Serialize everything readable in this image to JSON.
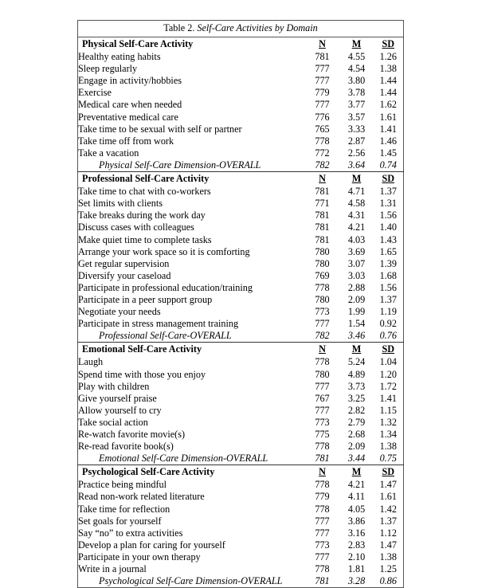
{
  "table": {
    "caption_label": "Table 2.",
    "caption_title": "Self-Care Activities by Domain",
    "columns": {
      "label": "",
      "n": "N",
      "m": "M",
      "sd": "SD"
    },
    "sections": [
      {
        "header": "Physical Self-Care Activity",
        "rows": [
          {
            "label": "Healthy eating habits",
            "n": "781",
            "m": "4.55",
            "sd": "1.26"
          },
          {
            "label": "Sleep regularly",
            "n": "777",
            "m": "4.54",
            "sd": "1.38"
          },
          {
            "label": "Engage in activity/hobbies",
            "n": "777",
            "m": "3.80",
            "sd": "1.44"
          },
          {
            "label": "Exercise",
            "n": "779",
            "m": "3.78",
            "sd": "1.44"
          },
          {
            "label": "Medical care when needed",
            "n": "777",
            "m": "3.77",
            "sd": "1.62"
          },
          {
            "label": "Preventative medical care",
            "n": "776",
            "m": "3.57",
            "sd": "1.61"
          },
          {
            "label": "Take time to be sexual with self or partner",
            "n": "765",
            "m": "3.33",
            "sd": "1.41"
          },
          {
            "label": "Take time off from work",
            "n": "778",
            "m": "2.87",
            "sd": "1.46"
          },
          {
            "label": "Take a vacation",
            "n": "772",
            "m": "2.56",
            "sd": "1.45"
          }
        ],
        "overall": {
          "label": "Physical Self-Care Dimension-OVERALL",
          "n": "782",
          "m": "3.64",
          "sd": "0.74"
        }
      },
      {
        "header": "Professional Self-Care Activity",
        "rows": [
          {
            "label": "Take time to chat with co-workers",
            "n": "781",
            "m": "4.71",
            "sd": "1.37"
          },
          {
            "label": "Set limits with clients",
            "n": "771",
            "m": "4.58",
            "sd": "1.31"
          },
          {
            "label": "Take breaks during the work day",
            "n": "781",
            "m": "4.31",
            "sd": "1.56"
          },
          {
            "label": "Discuss cases with colleagues",
            "n": "781",
            "m": "4.21",
            "sd": "1.40"
          },
          {
            "label": "Make quiet time to complete tasks",
            "n": "781",
            "m": "4.03",
            "sd": "1.43"
          },
          {
            "label": "Arrange your work space so it is comforting",
            "n": "780",
            "m": "3.69",
            "sd": "1.65"
          },
          {
            "label": "Get regular supervision",
            "n": "780",
            "m": "3.07",
            "sd": "1.39"
          },
          {
            "label": "Diversify your caseload",
            "n": "769",
            "m": "3.03",
            "sd": "1.68"
          },
          {
            "label": "Participate in professional education/training",
            "n": "778",
            "m": "2.88",
            "sd": "1.56"
          },
          {
            "label": "Participate in a peer support group",
            "n": "780",
            "m": "2.09",
            "sd": "1.37"
          },
          {
            "label": "Negotiate your needs",
            "n": "773",
            "m": "1.99",
            "sd": "1.19"
          },
          {
            "label": "Participate in stress management training",
            "n": "777",
            "m": "1.54",
            "sd": "0.92"
          }
        ],
        "overall": {
          "label": "Professional Self-Care-OVERALL",
          "n": "782",
          "m": "3.46",
          "sd": "0.76"
        }
      },
      {
        "header": "Emotional Self-Care Activity",
        "rows": [
          {
            "label": "Laugh",
            "n": "778",
            "m": "5.24",
            "sd": "1.04"
          },
          {
            "label": "Spend time with those you enjoy",
            "n": "780",
            "m": "4.89",
            "sd": "1.20"
          },
          {
            "label": "Play with children",
            "n": "777",
            "m": "3.73",
            "sd": "1.72"
          },
          {
            "label": "Give yourself praise",
            "n": "767",
            "m": "3.25",
            "sd": "1.41"
          },
          {
            "label": "Allow yourself to cry",
            "n": "777",
            "m": "2.82",
            "sd": "1.15"
          },
          {
            "label": "Take social action",
            "n": "773",
            "m": "2.79",
            "sd": "1.32"
          },
          {
            "label": "Re-watch favorite movie(s)",
            "n": "775",
            "m": "2.68",
            "sd": "1.34"
          },
          {
            "label": "Re-read favorite book(s)",
            "n": "778",
            "m": "2.09",
            "sd": "1.38"
          }
        ],
        "overall": {
          "label": "Emotional Self-Care Dimension-OVERALL",
          "n": "781",
          "m": "3.44",
          "sd": "0.75"
        }
      },
      {
        "header": "Psychological Self-Care Activity",
        "rows": [
          {
            "label": "Practice being mindful",
            "n": "778",
            "m": "4.21",
            "sd": "1.47"
          },
          {
            "label": "Read non-work related literature",
            "n": "779",
            "m": "4.11",
            "sd": "1.61"
          },
          {
            "label": "Take time for reflection",
            "n": "778",
            "m": "4.05",
            "sd": "1.42"
          },
          {
            "label": "Set goals for yourself",
            "n": "777",
            "m": "3.86",
            "sd": "1.37"
          },
          {
            "label": "Say “no” to extra activities",
            "n": "777",
            "m": "3.16",
            "sd": "1.12"
          },
          {
            "label": "Develop a plan for caring for yourself",
            "n": "773",
            "m": "2.83",
            "sd": "1.47"
          },
          {
            "label": "Participate in your own therapy",
            "n": "777",
            "m": "2.10",
            "sd": "1.38"
          },
          {
            "label": "Write in a journal",
            "n": "778",
            "m": "1.81",
            "sd": "1.25"
          }
        ],
        "overall": {
          "label": "Psychological Self-Care Dimension-OVERALL",
          "n": "781",
          "m": "3.28",
          "sd": "0.86"
        }
      }
    ]
  }
}
